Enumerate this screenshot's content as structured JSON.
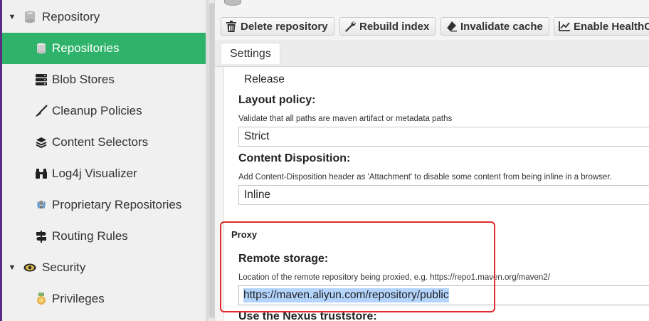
{
  "sidebar": {
    "groups": [
      {
        "label": "Repository",
        "icon": "database-icon",
        "expanded": true
      },
      {
        "label": "Security",
        "icon": "eye-icon",
        "expanded": true
      }
    ],
    "items": [
      {
        "label": "Repositories",
        "icon": "database-icon",
        "active": true
      },
      {
        "label": "Blob Stores",
        "icon": "server-icon"
      },
      {
        "label": "Cleanup Policies",
        "icon": "broom-icon"
      },
      {
        "label": "Content Selectors",
        "icon": "layers-icon"
      },
      {
        "label": "Log4j Visualizer",
        "icon": "binoculars-icon"
      },
      {
        "label": "Proprietary Repositories",
        "icon": "shield-icon"
      },
      {
        "label": "Routing Rules",
        "icon": "signpost-icon"
      },
      {
        "label": "Privileges",
        "icon": "medal-icon"
      }
    ]
  },
  "toolbar": {
    "delete_label": "Delete repository",
    "rebuild_label": "Rebuild index",
    "invalidate_label": "Invalidate cache",
    "health_label": "Enable HealthC"
  },
  "tabs": {
    "settings_label": "Settings"
  },
  "form": {
    "version_policy_value": "Release",
    "layout_policy": {
      "label": "Layout policy:",
      "help": "Validate that all paths are maven artifact or metadata paths",
      "value": "Strict"
    },
    "content_disposition": {
      "label": "Content Disposition:",
      "help": "Add Content-Disposition header as 'Attachment' to disable some content from being inline in a browser.",
      "value": "Inline"
    },
    "proxy": {
      "section_title": "Proxy",
      "remote_storage_label": "Remote storage:",
      "remote_storage_help": "Location of the remote repository being proxied, e.g. https://repo1.maven.org/maven2/",
      "remote_storage_value": "https://maven.aliyun.com/repository/public",
      "truststore_label": "Use the Nexus truststore:"
    }
  },
  "colors": {
    "active_item": "#2fb36a",
    "highlight_border": "#e12b2b",
    "text_selection": "#b3d4fc",
    "edge_strip": "#5b2c83"
  }
}
